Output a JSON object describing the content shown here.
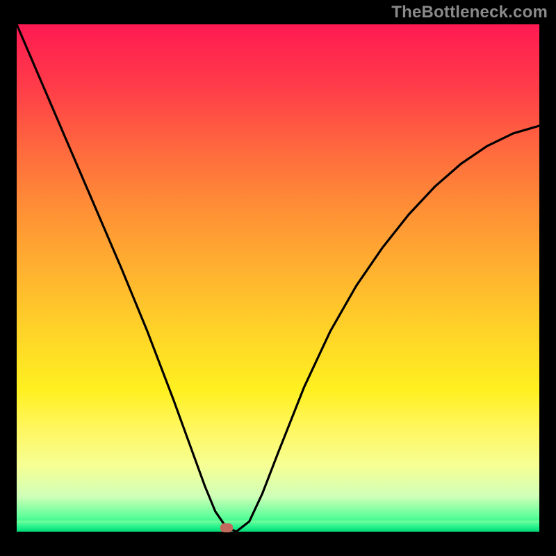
{
  "watermark": "TheBottleneck.com",
  "marker": {
    "x_fraction": 0.402,
    "y_fraction": 0.993,
    "color": "#c26a5e"
  },
  "gradient_colors": {
    "top": "#ff1a52",
    "mid": "#ffd228",
    "bottom": "#00e27a"
  },
  "frame_border_color": "#000000",
  "chart_data": {
    "type": "line",
    "title": "",
    "xlabel": "",
    "ylabel": "",
    "xlim": [
      0,
      1
    ],
    "ylim": [
      0,
      1
    ],
    "grid": false,
    "legend": false,
    "annotations": [],
    "background": "rainbow-gradient-red-to-green-vertical",
    "series": [
      {
        "name": "bottleneck-curve",
        "color": "#000000",
        "x": [
          0.0,
          0.05,
          0.1,
          0.15,
          0.2,
          0.25,
          0.3,
          0.33,
          0.36,
          0.38,
          0.4,
          0.42,
          0.445,
          0.47,
          0.5,
          0.55,
          0.6,
          0.65,
          0.7,
          0.75,
          0.8,
          0.85,
          0.9,
          0.95,
          1.0
        ],
        "values": [
          1.0,
          0.88,
          0.76,
          0.64,
          0.52,
          0.395,
          0.26,
          0.175,
          0.09,
          0.04,
          0.01,
          0.0,
          0.02,
          0.075,
          0.155,
          0.285,
          0.395,
          0.485,
          0.56,
          0.625,
          0.68,
          0.725,
          0.76,
          0.785,
          0.8
        ]
      }
    ],
    "marker": {
      "x": 0.402,
      "y": 0.007
    }
  }
}
